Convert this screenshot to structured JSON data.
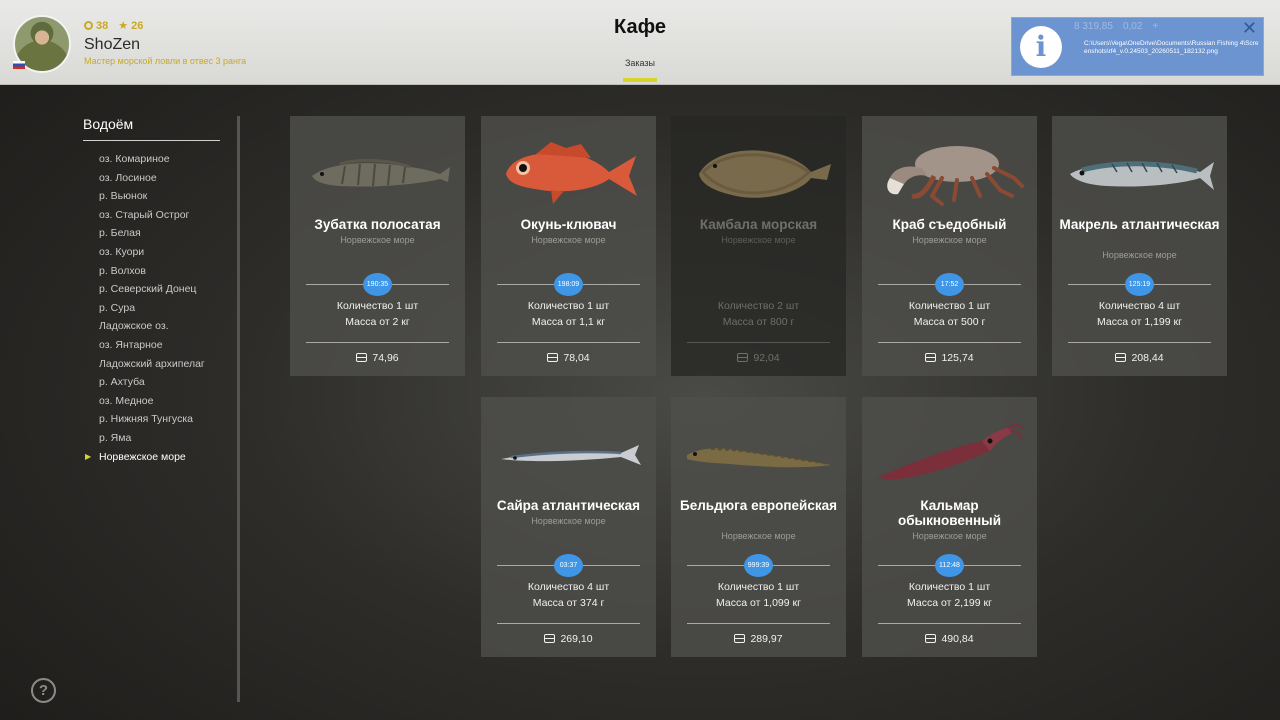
{
  "player": {
    "level": "38",
    "stars": "26",
    "name": "ShoZen",
    "rank": "Мастер морской ловли в отвес 3 ранга"
  },
  "page": {
    "title": "Кафе",
    "tab": "Заказы"
  },
  "notification": {
    "money": "8 319,85",
    "gold": "0,02",
    "path": "C:\\Users\\Vega\\OneDrive\\Documents\\Russian Fishing 4\\Screenshots\\rf4_v.0.24503_20260511_182132.png"
  },
  "sidebar": {
    "title": "Водоём",
    "items": [
      "оз. Комариное",
      "оз. Лосиное",
      "р. Вьюнок",
      "оз. Старый Острог",
      "р. Белая",
      "оз. Куори",
      "р. Волхов",
      "р. Северский Донец",
      "р. Сура",
      "Ладожское оз.",
      "оз. Янтарное",
      "Ладожский архипелаг",
      "р. Ахтуба",
      "оз. Медное",
      "р. Нижняя Тунгуска",
      "р. Яма",
      "Норвежское море"
    ],
    "active_index": 16
  },
  "orders": [
    {
      "name": "Зубатка полосатая",
      "location": "Норвежское море",
      "timer": "190:35",
      "qty": "Количество 1 шт",
      "mass": "Масса от 2 кг",
      "price": "74,96",
      "available": true
    },
    {
      "name": "Окунь-клювач",
      "location": "Норвежское море",
      "timer": "198:09",
      "qty": "Количество 1 шт",
      "mass": "Масса от 1,1 кг",
      "price": "78,04",
      "available": true
    },
    {
      "name": "Камбала морская",
      "location": "Норвежское море",
      "timer": "",
      "qty": "Количество 2 шт",
      "mass": "Масса от 800 г",
      "price": "92,04",
      "available": false
    },
    {
      "name": "Краб съедобный",
      "location": "Норвежское море",
      "timer": "17:52",
      "qty": "Количество 1 шт",
      "mass": "Масса от 500 г",
      "price": "125,74",
      "available": true
    },
    {
      "name": "Макрель атлантическая",
      "location": "Норвежское море",
      "timer": "125:19",
      "qty": "Количество 4 шт",
      "mass": "Масса от 1,199 кг",
      "price": "208,44",
      "available": true
    },
    {
      "name": "Сайра атлантическая",
      "location": "Норвежское море",
      "timer": "03:37",
      "qty": "Количество 4 шт",
      "mass": "Масса от 374 г",
      "price": "269,10",
      "available": true
    },
    {
      "name": "Бельдюга европейская",
      "location": "Норвежское море",
      "timer": "999:39",
      "qty": "Количество 1 шт",
      "mass": "Масса от 1,099 кг",
      "price": "289,97",
      "available": true
    },
    {
      "name": "Кальмар обыкновенный",
      "location": "Норвежское море",
      "timer": "112:48",
      "qty": "Количество 1 шт",
      "mass": "Масса от 2,199 кг",
      "price": "490,84",
      "available": true
    }
  ],
  "icons": {
    "help": "?",
    "info": "i",
    "close": "✕",
    "level": "ring-icon",
    "stars": "star-icon",
    "price": "coin-icon"
  }
}
